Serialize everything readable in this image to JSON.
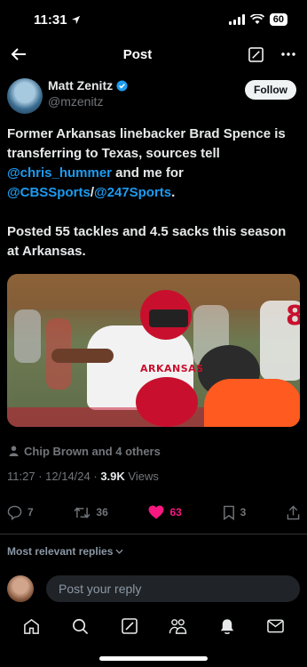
{
  "status_bar": {
    "time": "11:31",
    "battery": "60"
  },
  "header": {
    "title": "Post"
  },
  "author": {
    "name": "Matt Zenitz",
    "handle": "@mzenitz",
    "follow_label": "Follow"
  },
  "tweet": {
    "seg1": "Former Arkansas linebacker Brad Spence is transferring to Texas, sources tell ",
    "mention1": "@chris_hummer",
    "seg2": " and me for ",
    "mention2": "@CBSSports",
    "seg3": "/",
    "mention3": "@247Sports",
    "seg4": ".",
    "paragraph2": "Posted 55 tackles and 4.5 sacks this season at Arkansas."
  },
  "media": {
    "jersey_text": "ARKANSAS",
    "jersey_number": "8"
  },
  "liked_by": "Chip Brown and 4 others",
  "meta": {
    "time": "11:27",
    "sep": " · ",
    "date": "12/14/24",
    "views_count": "3.9K",
    "views_label": "Views"
  },
  "actions": {
    "replies": "7",
    "reposts": "36",
    "likes": "63",
    "bookmarks": "3"
  },
  "replies_sort": "Most relevant replies",
  "reply_bar": {
    "placeholder": "Post your reply"
  },
  "colors": {
    "accent": "#1d9bf0",
    "like": "#f91880",
    "background": "#000000"
  },
  "icons": [
    "back-arrow-icon",
    "compose-icon",
    "more-icon",
    "verified-icon",
    "person-icon",
    "reply-icon",
    "repost-icon",
    "heart-icon",
    "bookmark-icon",
    "share-icon",
    "home-icon",
    "search-icon",
    "grok-icon",
    "people-icon",
    "bell-icon",
    "mail-icon"
  ]
}
